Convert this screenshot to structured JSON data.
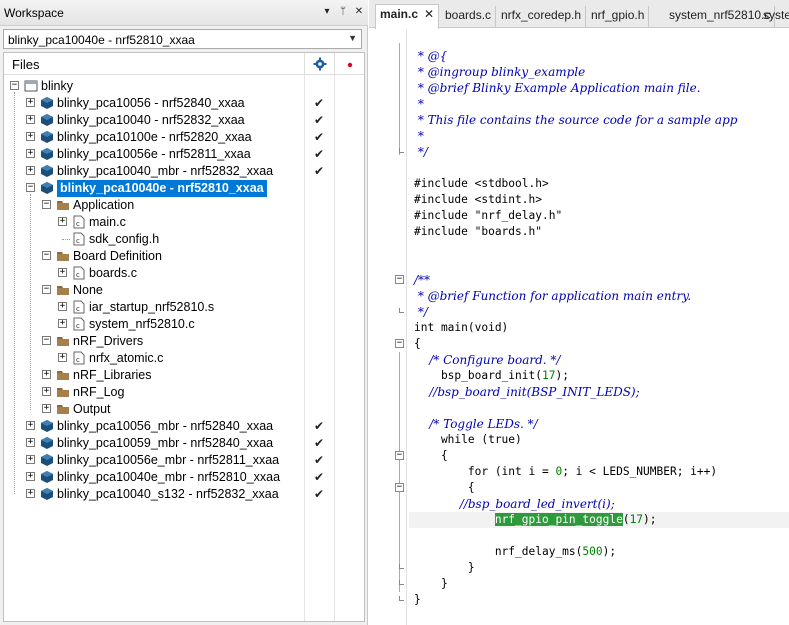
{
  "workspace": {
    "title": "Workspace",
    "pin_glyph": "▾",
    "pin2_glyph": "ᛘ",
    "close_glyph": "✕",
    "config": "blinky_pca10040e - nrf52810_xxaa",
    "files_label": "Files",
    "check": "✔",
    "tree": [
      {
        "label": "blinky",
        "type": "workspace",
        "expander": "⊟"
      },
      {
        "label": "blinky_pca10056 - nrf52840_xxaa",
        "type": "project",
        "expander": "+",
        "checked": true
      },
      {
        "label": "blinky_pca10040 - nrf52832_xxaa",
        "type": "project",
        "expander": "+",
        "checked": true
      },
      {
        "label": "blinky_pca10100e - nrf52820_xxaa",
        "type": "project",
        "expander": "+",
        "checked": true
      },
      {
        "label": "blinky_pca10056e - nrf52811_xxaa",
        "type": "project",
        "expander": "+",
        "checked": true
      },
      {
        "label": "blinky_pca10040_mbr - nrf52832_xxaa",
        "type": "project",
        "expander": "+",
        "checked": true
      },
      {
        "label": "blinky_pca10040e - nrf52810_xxaa",
        "type": "project",
        "expander": "−",
        "checked": true,
        "selected": true
      },
      {
        "label": "Application",
        "type": "folder",
        "expander": "−"
      },
      {
        "label": "main.c",
        "type": "file",
        "expander": "+"
      },
      {
        "label": "sdk_config.h",
        "type": "file"
      },
      {
        "label": "Board Definition",
        "type": "folder",
        "expander": "−"
      },
      {
        "label": "boards.c",
        "type": "file",
        "expander": "+"
      },
      {
        "label": "None",
        "type": "folder",
        "expander": "−"
      },
      {
        "label": "iar_startup_nrf52810.s",
        "type": "file",
        "expander": "+"
      },
      {
        "label": "system_nrf52810.c",
        "type": "file",
        "expander": "+"
      },
      {
        "label": "nRF_Drivers",
        "type": "folder",
        "expander": "−"
      },
      {
        "label": "nrfx_atomic.c",
        "type": "file",
        "expander": "+"
      },
      {
        "label": "nRF_Libraries",
        "type": "folder",
        "expander": "+"
      },
      {
        "label": "nRF_Log",
        "type": "folder",
        "expander": "+"
      },
      {
        "label": "Output",
        "type": "folder",
        "expander": "+"
      },
      {
        "label": "blinky_pca10056_mbr - nrf52840_xxaa",
        "type": "project",
        "expander": "+",
        "checked": true
      },
      {
        "label": "blinky_pca10059_mbr - nrf52840_xxaa",
        "type": "project",
        "expander": "+",
        "checked": true
      },
      {
        "label": "blinky_pca10056e_mbr - nrf52811_xxaa",
        "type": "project",
        "expander": "+",
        "checked": true
      },
      {
        "label": "blinky_pca10040e_mbr - nrf52810_xxaa",
        "type": "project",
        "expander": "+",
        "checked": true
      },
      {
        "label": "blinky_pca10040_s132 - nrf52832_xxaa",
        "type": "project",
        "expander": "+",
        "checked": true
      }
    ]
  },
  "editor": {
    "tabs": [
      {
        "label": "main.c",
        "active": true,
        "close": "✕"
      },
      {
        "label": "boards.c"
      },
      {
        "label": "nrfx_coredep.h"
      },
      {
        "label": "nrf_gpio.h"
      },
      {
        "label": "system_nrf52810.c"
      },
      {
        "label": "syste"
      }
    ],
    "lines": [
      {
        "text": " * @{",
        "kind": "cmt"
      },
      {
        "text": " * @ingroup blinky_example",
        "kind": "cmt"
      },
      {
        "text": " * @brief Blinky Example Application main file.",
        "kind": "cmt"
      },
      {
        "text": " *",
        "kind": "cmt"
      },
      {
        "text": " * This file contains the source code for a sample app",
        "kind": "cmt"
      },
      {
        "text": " *",
        "kind": "cmt"
      },
      {
        "text": " */",
        "kind": "cmt"
      },
      {
        "text": "",
        "kind": "code"
      },
      {
        "text": "#include <stdbool.h>",
        "kind": "code"
      },
      {
        "text": "#include <stdint.h>",
        "kind": "code"
      },
      {
        "text": "#include \"nrf_delay.h\"",
        "kind": "code"
      },
      {
        "text": "#include \"boards.h\"",
        "kind": "code"
      },
      {
        "text": "",
        "kind": "code"
      },
      {
        "text": "",
        "kind": "code"
      },
      {
        "text": "/**",
        "kind": "cmt"
      },
      {
        "text": " * @brief Function for application main entry.",
        "kind": "cmt"
      },
      {
        "text": " */",
        "kind": "cmt"
      },
      {
        "text": "int main(void)",
        "kind": "code"
      },
      {
        "text": "{",
        "kind": "code"
      },
      {
        "text": "    /* Configure board. */",
        "kind": "cmt"
      },
      {
        "pre": "    bsp_board_init(",
        "num": "17",
        "post": ");",
        "kind": "mixed"
      },
      {
        "text": "    //bsp_board_init(BSP_INIT_LEDS);",
        "kind": "cmt"
      },
      {
        "text": "",
        "kind": "code"
      },
      {
        "text": "    /* Toggle LEDs. */",
        "kind": "cmt"
      },
      {
        "text": "    while (true)",
        "kind": "code"
      },
      {
        "text": "    {",
        "kind": "code"
      },
      {
        "pre": "        for (int i = ",
        "num": "0",
        "post": "; i < LEDS_NUMBER; i++)",
        "kind": "mixed"
      },
      {
        "text": "        {",
        "kind": "code"
      },
      {
        "text": "            //bsp_board_led_invert(i);",
        "kind": "cmt"
      },
      {
        "indent": "            ",
        "hl": "nrf_gpio_pin_toggle",
        "mid": "(",
        "num": "17",
        "post": ");",
        "kind": "highlight"
      },
      {
        "text": "",
        "kind": "code"
      },
      {
        "pre": "            nrf_delay_ms(",
        "num": "500",
        "post": ");",
        "kind": "mixed"
      },
      {
        "text": "        }",
        "kind": "code"
      },
      {
        "text": "    }",
        "kind": "code"
      },
      {
        "text": "}",
        "kind": "code"
      }
    ]
  }
}
